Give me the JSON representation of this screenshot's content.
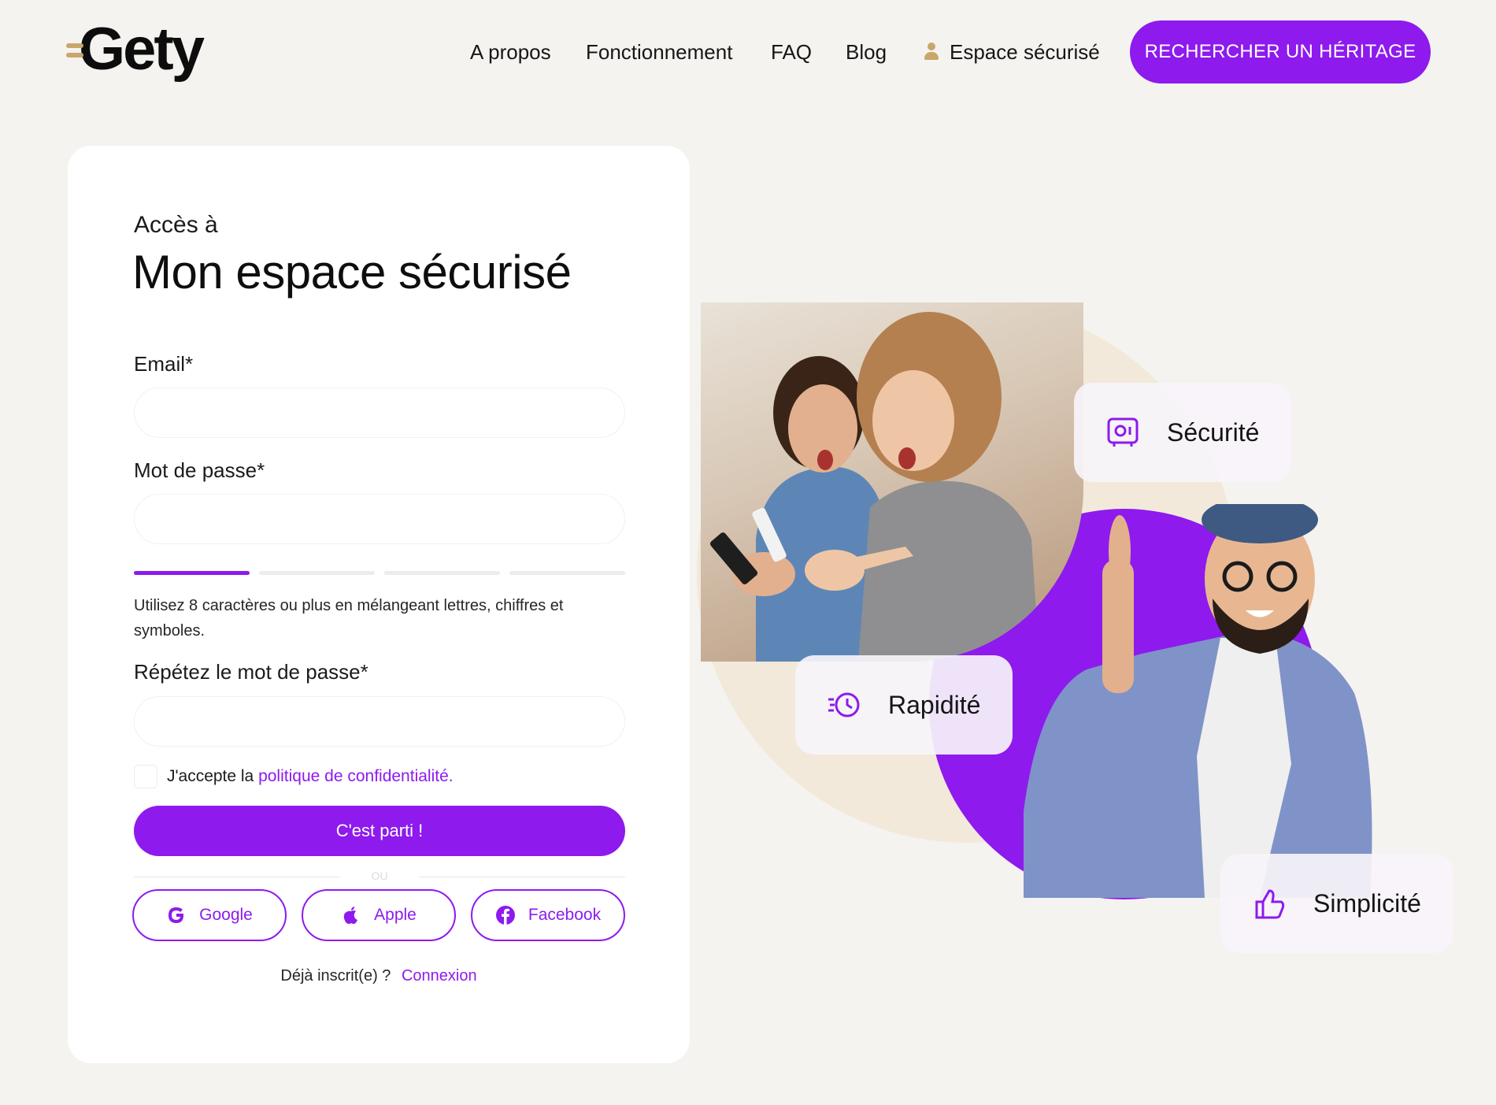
{
  "header": {
    "logo": "Gety",
    "nav": [
      "A propos",
      "Fonctionnement",
      "FAQ",
      "Blog"
    ],
    "secure_space": "Espace sécurisé",
    "cta": "RECHERCHER UN HÉRITAGE"
  },
  "form": {
    "kicker": "Accès à",
    "title": "Mon espace sécurisé",
    "email_label": "Email*",
    "email_value": "",
    "password_label": "Mot de passe*",
    "password_value": "",
    "password_strength": 0.25,
    "hint": "Utilisez 8 caractères ou plus en mélangeant lettres, chiffres et symboles.",
    "repeat_label": "Répétez le mot de passe*",
    "repeat_value": "",
    "accept_prefix": "J'accepte la ",
    "accept_link": "politique de confidentialité.",
    "submit": "C'est parti !",
    "separator": "OU",
    "google": "Google",
    "apple": "Apple",
    "facebook": "Facebook",
    "already": "Déjà inscrit(e) ?",
    "login": "Connexion"
  },
  "badges": {
    "security": "Sécurité",
    "speed": "Rapidité",
    "simplicity": "Simplicité"
  },
  "colors": {
    "accent": "#8e1aed",
    "gold": "#c9a66b",
    "background": "#f4f3ef",
    "beige_circle": "#f2e9da"
  }
}
